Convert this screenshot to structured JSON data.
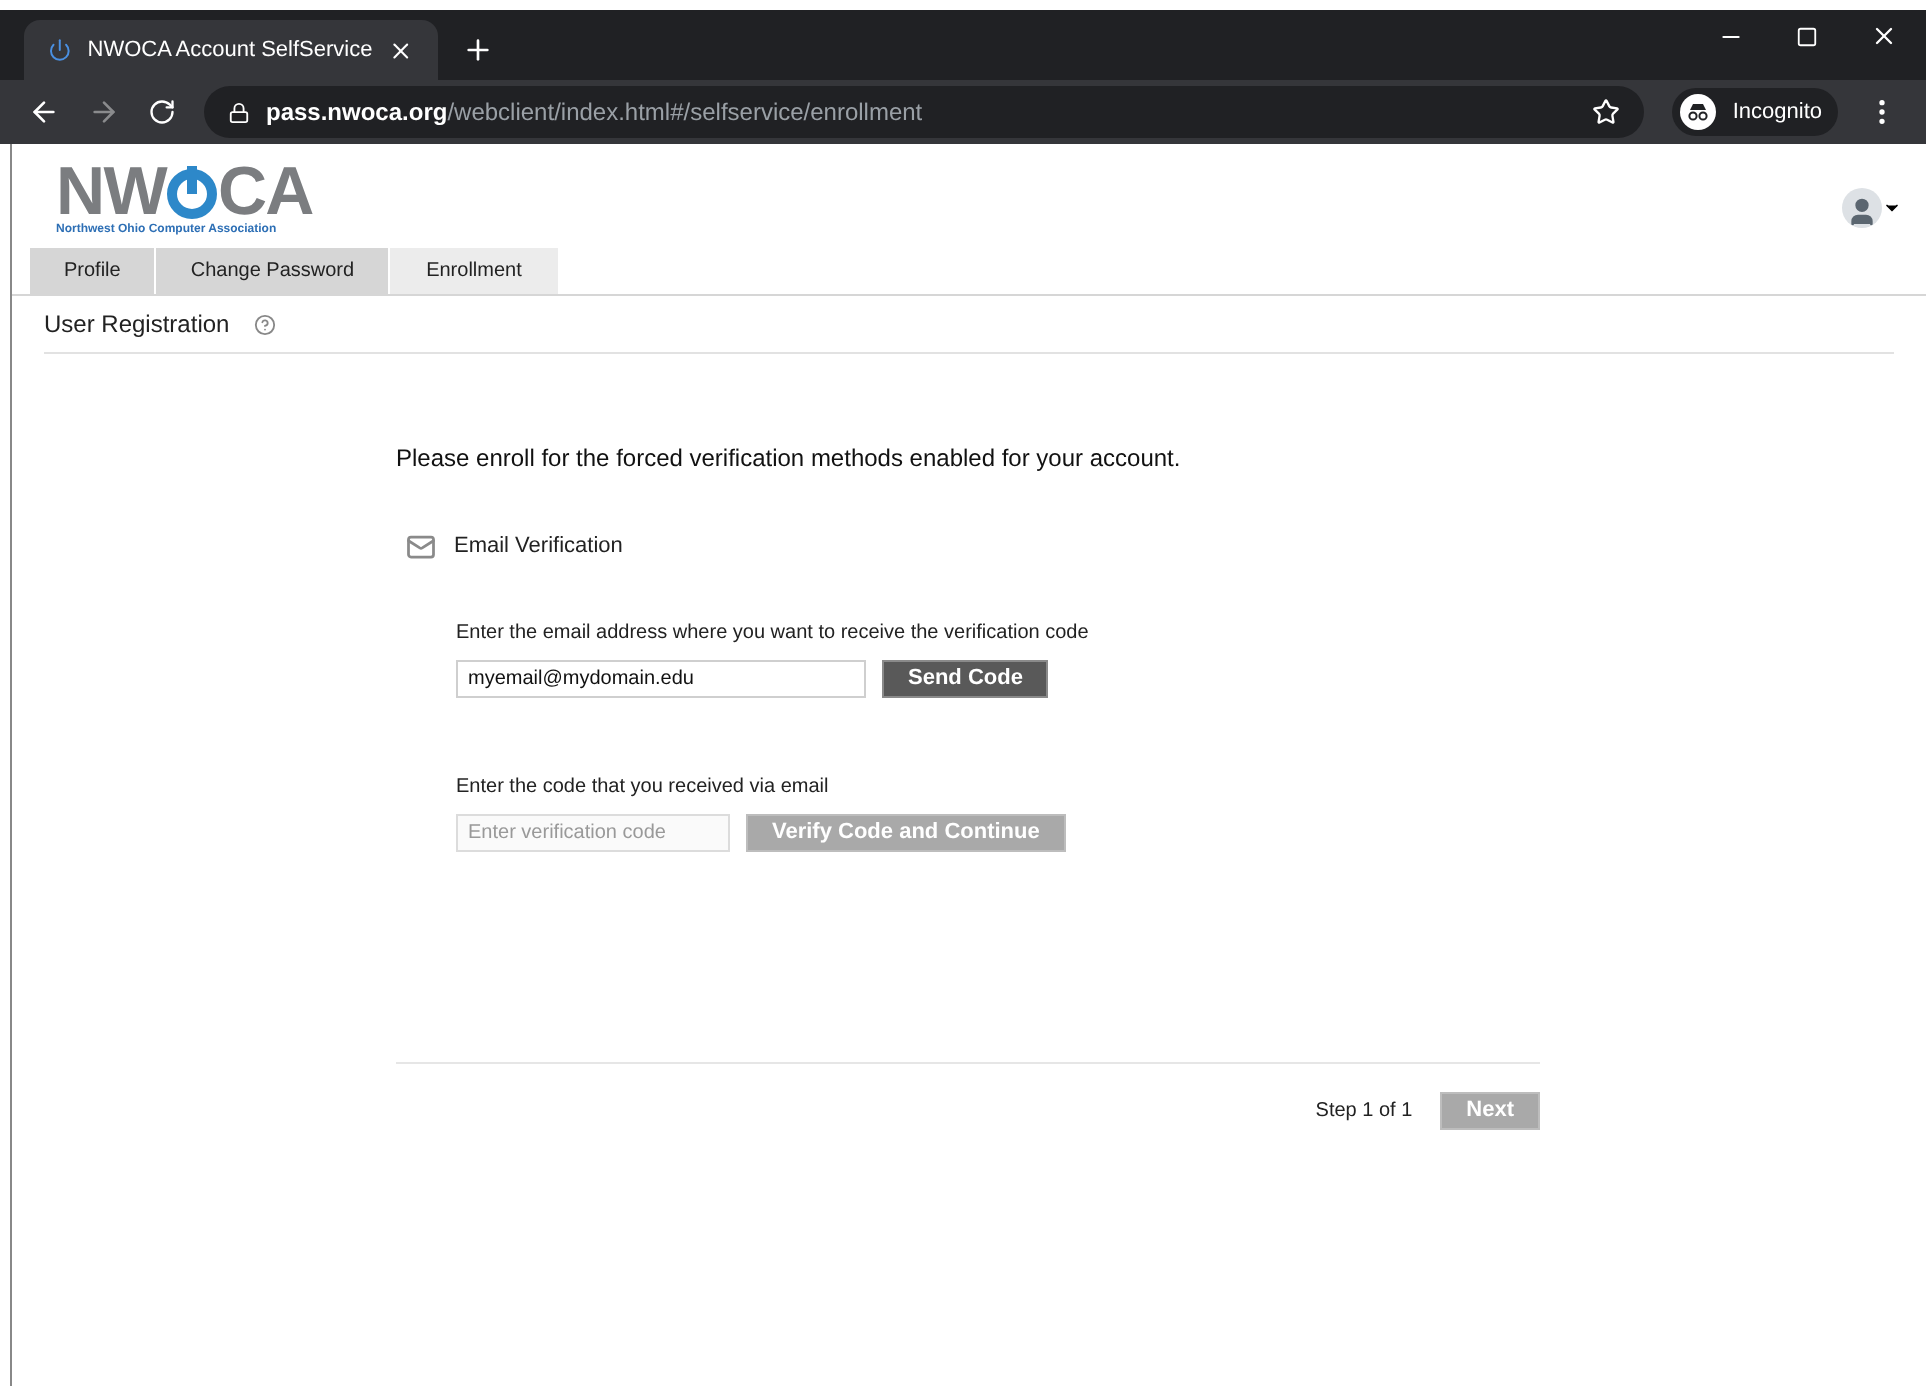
{
  "browser": {
    "tab_title": "NWOCA Account SelfService",
    "url_host": "pass.nwoca.org",
    "url_path": "/webclient/index.html#/selfservice/enrollment",
    "profile_label": "Incognito"
  },
  "logo": {
    "wordmark_left": "NW",
    "wordmark_right": "CA",
    "tagline": "Northwest Ohio Computer Association"
  },
  "tabs": [
    {
      "label": "Profile",
      "selected": false
    },
    {
      "label": "Change Password",
      "selected": false
    },
    {
      "label": "Enrollment",
      "selected": true
    }
  ],
  "section_title": "User Registration",
  "intro": "Please enroll for the forced verification methods enabled for your account.",
  "method": {
    "title": "Email Verification",
    "email_label": "Enter the email address where you want to receive the verification code",
    "email_value": "myemail@mydomain.edu",
    "send_button": {
      "label": "Send Code",
      "disabled": false
    },
    "code_label": "Enter the code that you received via email",
    "code_placeholder": "Enter verification code",
    "verify_button": {
      "label": "Verify Code and Continue",
      "disabled": true
    }
  },
  "footer": {
    "step": "Step 1 of 1",
    "next_button": {
      "label": "Next",
      "disabled": true
    }
  }
}
